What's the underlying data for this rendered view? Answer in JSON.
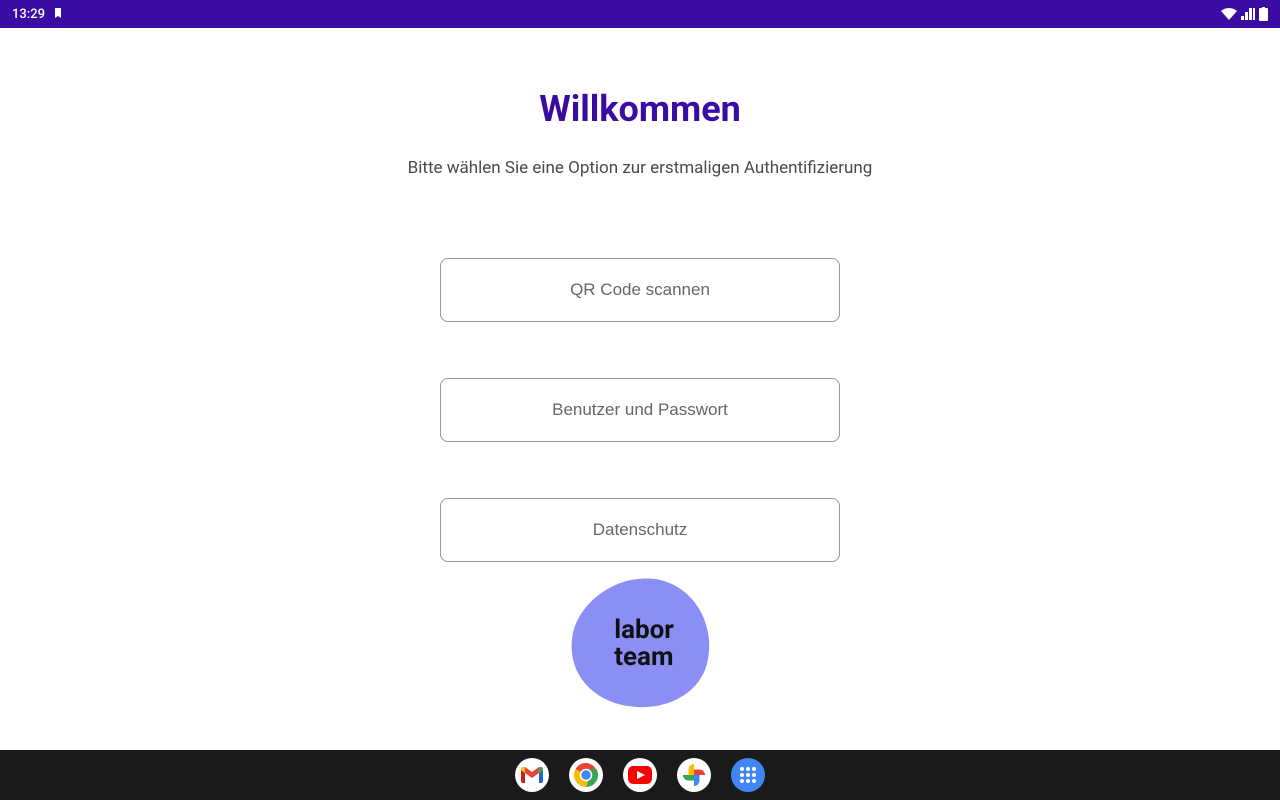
{
  "status_bar": {
    "time": "13:29"
  },
  "header": {
    "title": "Willkommen",
    "subtitle": "Bitte wählen Sie eine Option zur erstmaligen Authentifizierung"
  },
  "options": {
    "qr_scan": "QR Code scannen",
    "user_password": "Benutzer und Passwort",
    "privacy": "Datenschutz"
  },
  "logo": {
    "line1": "labor",
    "line2": "team"
  },
  "colors": {
    "primary": "#3a0ca3",
    "logo_blob": "#8b8ef5"
  }
}
